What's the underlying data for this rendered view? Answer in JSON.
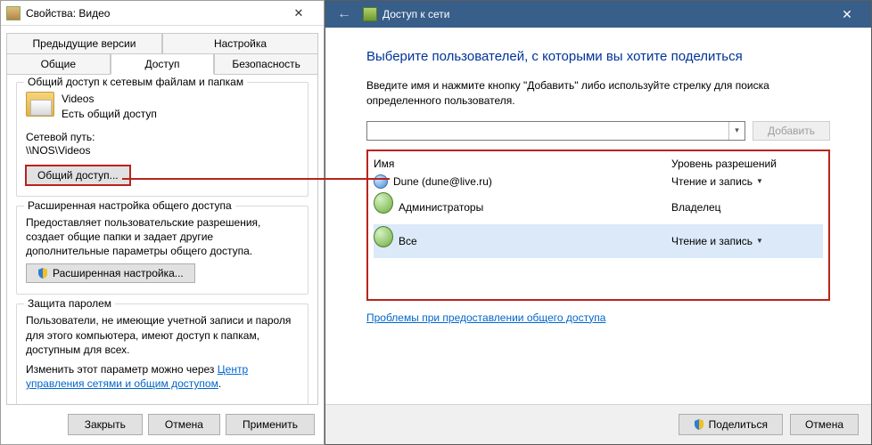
{
  "props": {
    "title": "Свойства: Видео",
    "tabs": {
      "prev_versions": "Предыдущие версии",
      "customize": "Настройка",
      "general": "Общие",
      "sharing": "Доступ",
      "security": "Безопасность"
    },
    "group_network": {
      "title": "Общий доступ к сетевым файлам и папкам",
      "folder_name": "Videos",
      "folder_state": "Есть общий доступ",
      "netpath_label": "Сетевой путь:",
      "netpath_value": "\\\\NOS\\Videos",
      "share_btn": "Общий доступ..."
    },
    "group_adv": {
      "title": "Расширенная настройка общего доступа",
      "desc": "Предоставляет пользовательские разрешения, создает общие папки и задает другие дополнительные параметры общего доступа.",
      "btn": "Расширенная настройка..."
    },
    "group_pwd": {
      "title": "Защита паролем",
      "desc": "Пользователи, не имеющие учетной записи и пароля для этого компьютера, имеют доступ к папкам, доступным для всех.",
      "change_prefix": "Изменить этот параметр можно через ",
      "change_link": "Центр управления сетями и общим доступом",
      "change_suffix": "."
    },
    "footer": {
      "close": "Закрыть",
      "cancel": "Отмена",
      "apply": "Применить"
    }
  },
  "wizard": {
    "title": "Доступ к сети",
    "heading": "Выберите пользователей, с которыми вы хотите поделиться",
    "sub": "Введите имя и нажмите кнопку \"Добавить\" либо используйте стрелку для поиска определенного пользователя.",
    "add_btn": "Добавить",
    "cols": {
      "name": "Имя",
      "perm": "Уровень разрешений"
    },
    "users": [
      {
        "icon": "user",
        "name": "Dune  (dune@live.ru)",
        "perm": "Чтение и запись",
        "dropdown": true,
        "selected": false
      },
      {
        "icon": "group",
        "name": "Администраторы",
        "perm": "Владелец",
        "dropdown": false,
        "selected": false
      },
      {
        "icon": "group",
        "name": "Все",
        "perm": "Чтение и запись",
        "dropdown": true,
        "selected": true
      }
    ],
    "trouble_link": "Проблемы при предоставлении общего доступа",
    "footer": {
      "share": "Поделиться",
      "cancel": "Отмена"
    }
  }
}
